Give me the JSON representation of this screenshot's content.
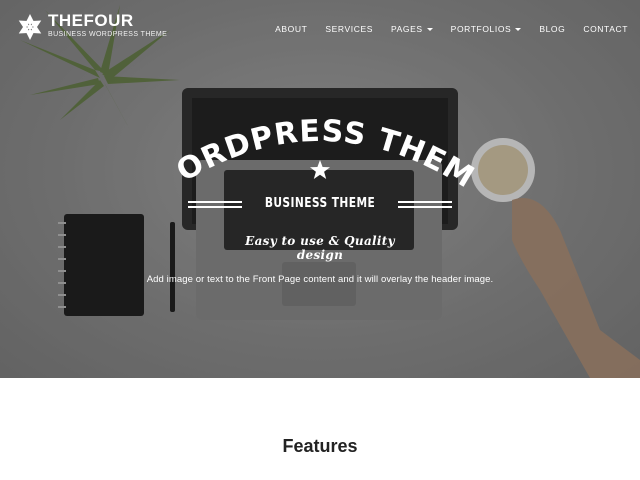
{
  "brand": {
    "name": "THEFOUR",
    "tagline": "BUSINESS WORDPRESS THEME",
    "logo_icon": "snowflake-flower-icon"
  },
  "nav": {
    "items": [
      {
        "label": "ABOUT",
        "dropdown": false
      },
      {
        "label": "SERVICES",
        "dropdown": false
      },
      {
        "label": "PAGES",
        "dropdown": true
      },
      {
        "label": "PORTFOLIOS",
        "dropdown": true
      },
      {
        "label": "BLOG",
        "dropdown": false
      },
      {
        "label": "CONTACT",
        "dropdown": false
      }
    ]
  },
  "hero": {
    "headline": "WORDPRESS THEME",
    "subtitle": "BUSINESS THEME",
    "script_text": "Easy to use & Quality design",
    "body_text": "Add image or text to the Front Page content and it will overlay the header image."
  },
  "features": {
    "title": "Features"
  },
  "colors": {
    "overlay_text": "#ffffff",
    "heading_dark": "#222222",
    "background": "#ffffff"
  }
}
